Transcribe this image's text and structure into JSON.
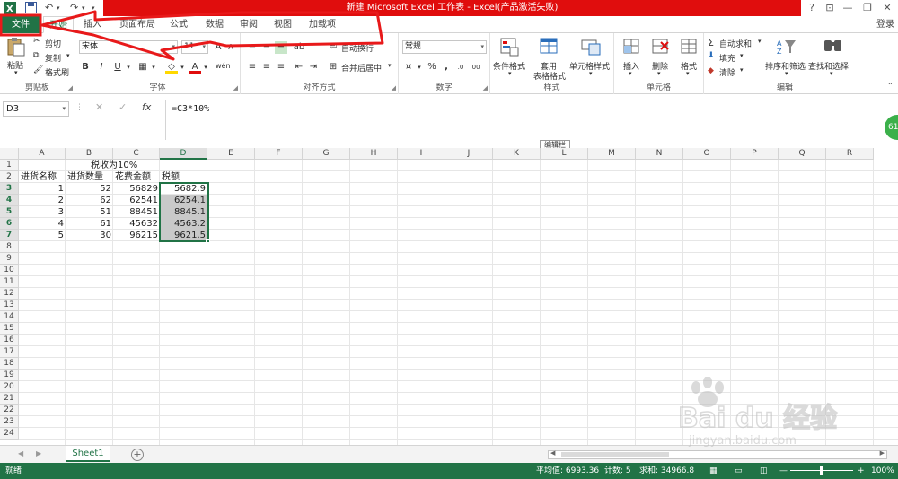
{
  "titlebar": {
    "title": "新建 Microsoft Excel 工作表 - Excel(产品激活失败)",
    "help": "?",
    "ribbon_opts": "⊡",
    "minimize": "—",
    "restore": "❐",
    "close": "✕"
  },
  "tabs": {
    "file": "文件",
    "home": "开始",
    "insert": "插入",
    "page_layout": "页面布局",
    "formulas": "公式",
    "data": "数据",
    "review": "审阅",
    "view": "视图",
    "addins": "加载项",
    "login": "登录"
  },
  "ribbon": {
    "clipboard": {
      "label": "剪贴板",
      "paste": "粘贴",
      "cut": "剪切",
      "copy": "复制",
      "format_painter": "格式刷"
    },
    "font": {
      "label": "字体",
      "font_name": "宋体",
      "font_size": "11",
      "bold": "B",
      "italic": "I",
      "underline": "U",
      "phonetic": "wén"
    },
    "alignment": {
      "label": "对齐方式",
      "wrap": "自动换行",
      "merge": "合并后居中"
    },
    "number": {
      "label": "数字",
      "format": "常规",
      "percent": "%",
      "comma": ","
    },
    "styles": {
      "label": "样式",
      "conditional": "条件格式",
      "table_line1": "套用",
      "table_line2": "表格格式",
      "cell_styles": "单元格样式"
    },
    "cells": {
      "label": "单元格",
      "insert": "插入",
      "delete": "删除",
      "format": "格式"
    },
    "editing": {
      "label": "编辑",
      "autosum": "自动求和",
      "fill": "填充",
      "clear": "清除",
      "sort_filter": "排序和筛选",
      "find_select": "查找和选择"
    }
  },
  "formula_bar": {
    "name_box": "D3",
    "fx": "fx",
    "formula": "=C3*10%",
    "tooltip": "编辑栏",
    "side_badge": "61"
  },
  "columns": [
    "A",
    "B",
    "C",
    "D",
    "E",
    "F",
    "G",
    "H",
    "I",
    "J",
    "K",
    "L",
    "M",
    "N",
    "O",
    "P",
    "Q",
    "R"
  ],
  "rows": [
    "1",
    "2",
    "3",
    "4",
    "5",
    "6",
    "7",
    "8",
    "9",
    "10",
    "11",
    "12",
    "13",
    "14",
    "15",
    "16",
    "17",
    "18",
    "19",
    "20",
    "21",
    "22",
    "23",
    "24"
  ],
  "sheet": {
    "b1": "税收为10%",
    "headers": [
      "进货名称",
      "进货数量",
      "花费金额",
      "税额"
    ],
    "data": [
      [
        "1",
        "52",
        "56829",
        "5682.9"
      ],
      [
        "2",
        "62",
        "62541",
        "6254.1"
      ],
      [
        "3",
        "51",
        "88451",
        "8845.1"
      ],
      [
        "4",
        "61",
        "45632",
        "4563.2"
      ],
      [
        "5",
        "30",
        "96215",
        "9621.5"
      ]
    ]
  },
  "sheet_tabs": {
    "sheet1": "Sheet1",
    "add": "+",
    "nav_left": "◀",
    "nav_right": "▶"
  },
  "status": {
    "ready": "就绪",
    "average": "平均值: 6993.36",
    "count": "计数: 5",
    "sum": "求和: 34966.8",
    "zoom": "100%"
  },
  "watermark": {
    "text": "Bai du 经验",
    "url": "jingyan.baidu.com"
  },
  "colors": {
    "excel_green": "#217346",
    "title_red": "#e00d0d",
    "annotation_red": "#e8191a",
    "shade": "#c9c9c9"
  }
}
